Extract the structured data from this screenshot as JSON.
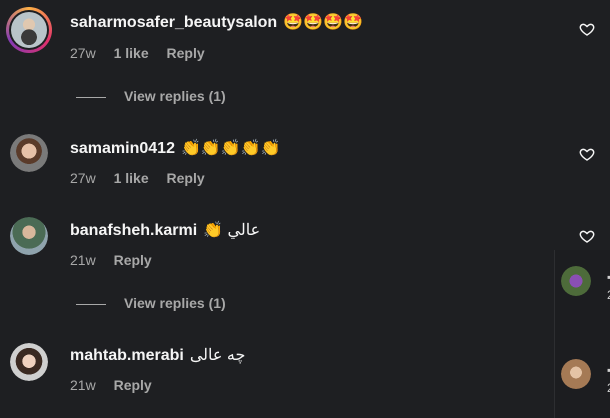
{
  "comments": [
    {
      "username": "saharmosafer_beautysalon",
      "text": "🤩🤩🤩🤩",
      "time": "27w",
      "likes": "1 like",
      "reply": "Reply",
      "view_replies": "View replies (1)",
      "avatar_icon": "profile-photo-ring"
    },
    {
      "username": "samamin0412",
      "text": "👏👏👏👏👏",
      "time": "27w",
      "likes": "1 like",
      "reply": "Reply",
      "avatar_icon": "profile-photo"
    },
    {
      "username": "banafsheh.karmi",
      "text": "👏 عالي",
      "time": "21w",
      "reply": "Reply",
      "view_replies": "View replies (1)",
      "avatar_icon": "profile-photo"
    },
    {
      "username": "mahtab.merabi",
      "text": "چه عالی",
      "time": "21w",
      "reply": "Reply",
      "avatar_icon": "profile-photo"
    }
  ],
  "side_panel": {
    "marks": [
      "▪",
      "2",
      "▪",
      "2"
    ]
  },
  "colors": {
    "background": "#1e1f22",
    "text": "#f5f5f5",
    "muted": "#a8a8a8"
  }
}
